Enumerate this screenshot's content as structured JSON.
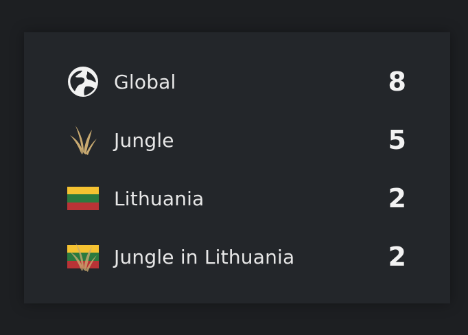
{
  "ranks": [
    {
      "id": "global",
      "label": "Global",
      "count": "8",
      "icon": "globe-icon"
    },
    {
      "id": "jungle",
      "label": "Jungle",
      "count": "5",
      "icon": "jungle-icon"
    },
    {
      "id": "lithuania",
      "label": "Lithuania",
      "count": "2",
      "icon": "lithuania-flag-icon"
    },
    {
      "id": "jungle-lithuania",
      "label": "Jungle in Lithuania",
      "count": "2",
      "icon": "jungle-lithuania-icon"
    }
  ],
  "colors": {
    "background": "#1d1f22",
    "panel": "#23262a",
    "text": "#e7e7e7",
    "count": "#f2f2f2",
    "gold": "#c9aa71",
    "flag_yellow": "#f5c231",
    "flag_green": "#2b7a3f",
    "flag_red": "#b93336"
  }
}
